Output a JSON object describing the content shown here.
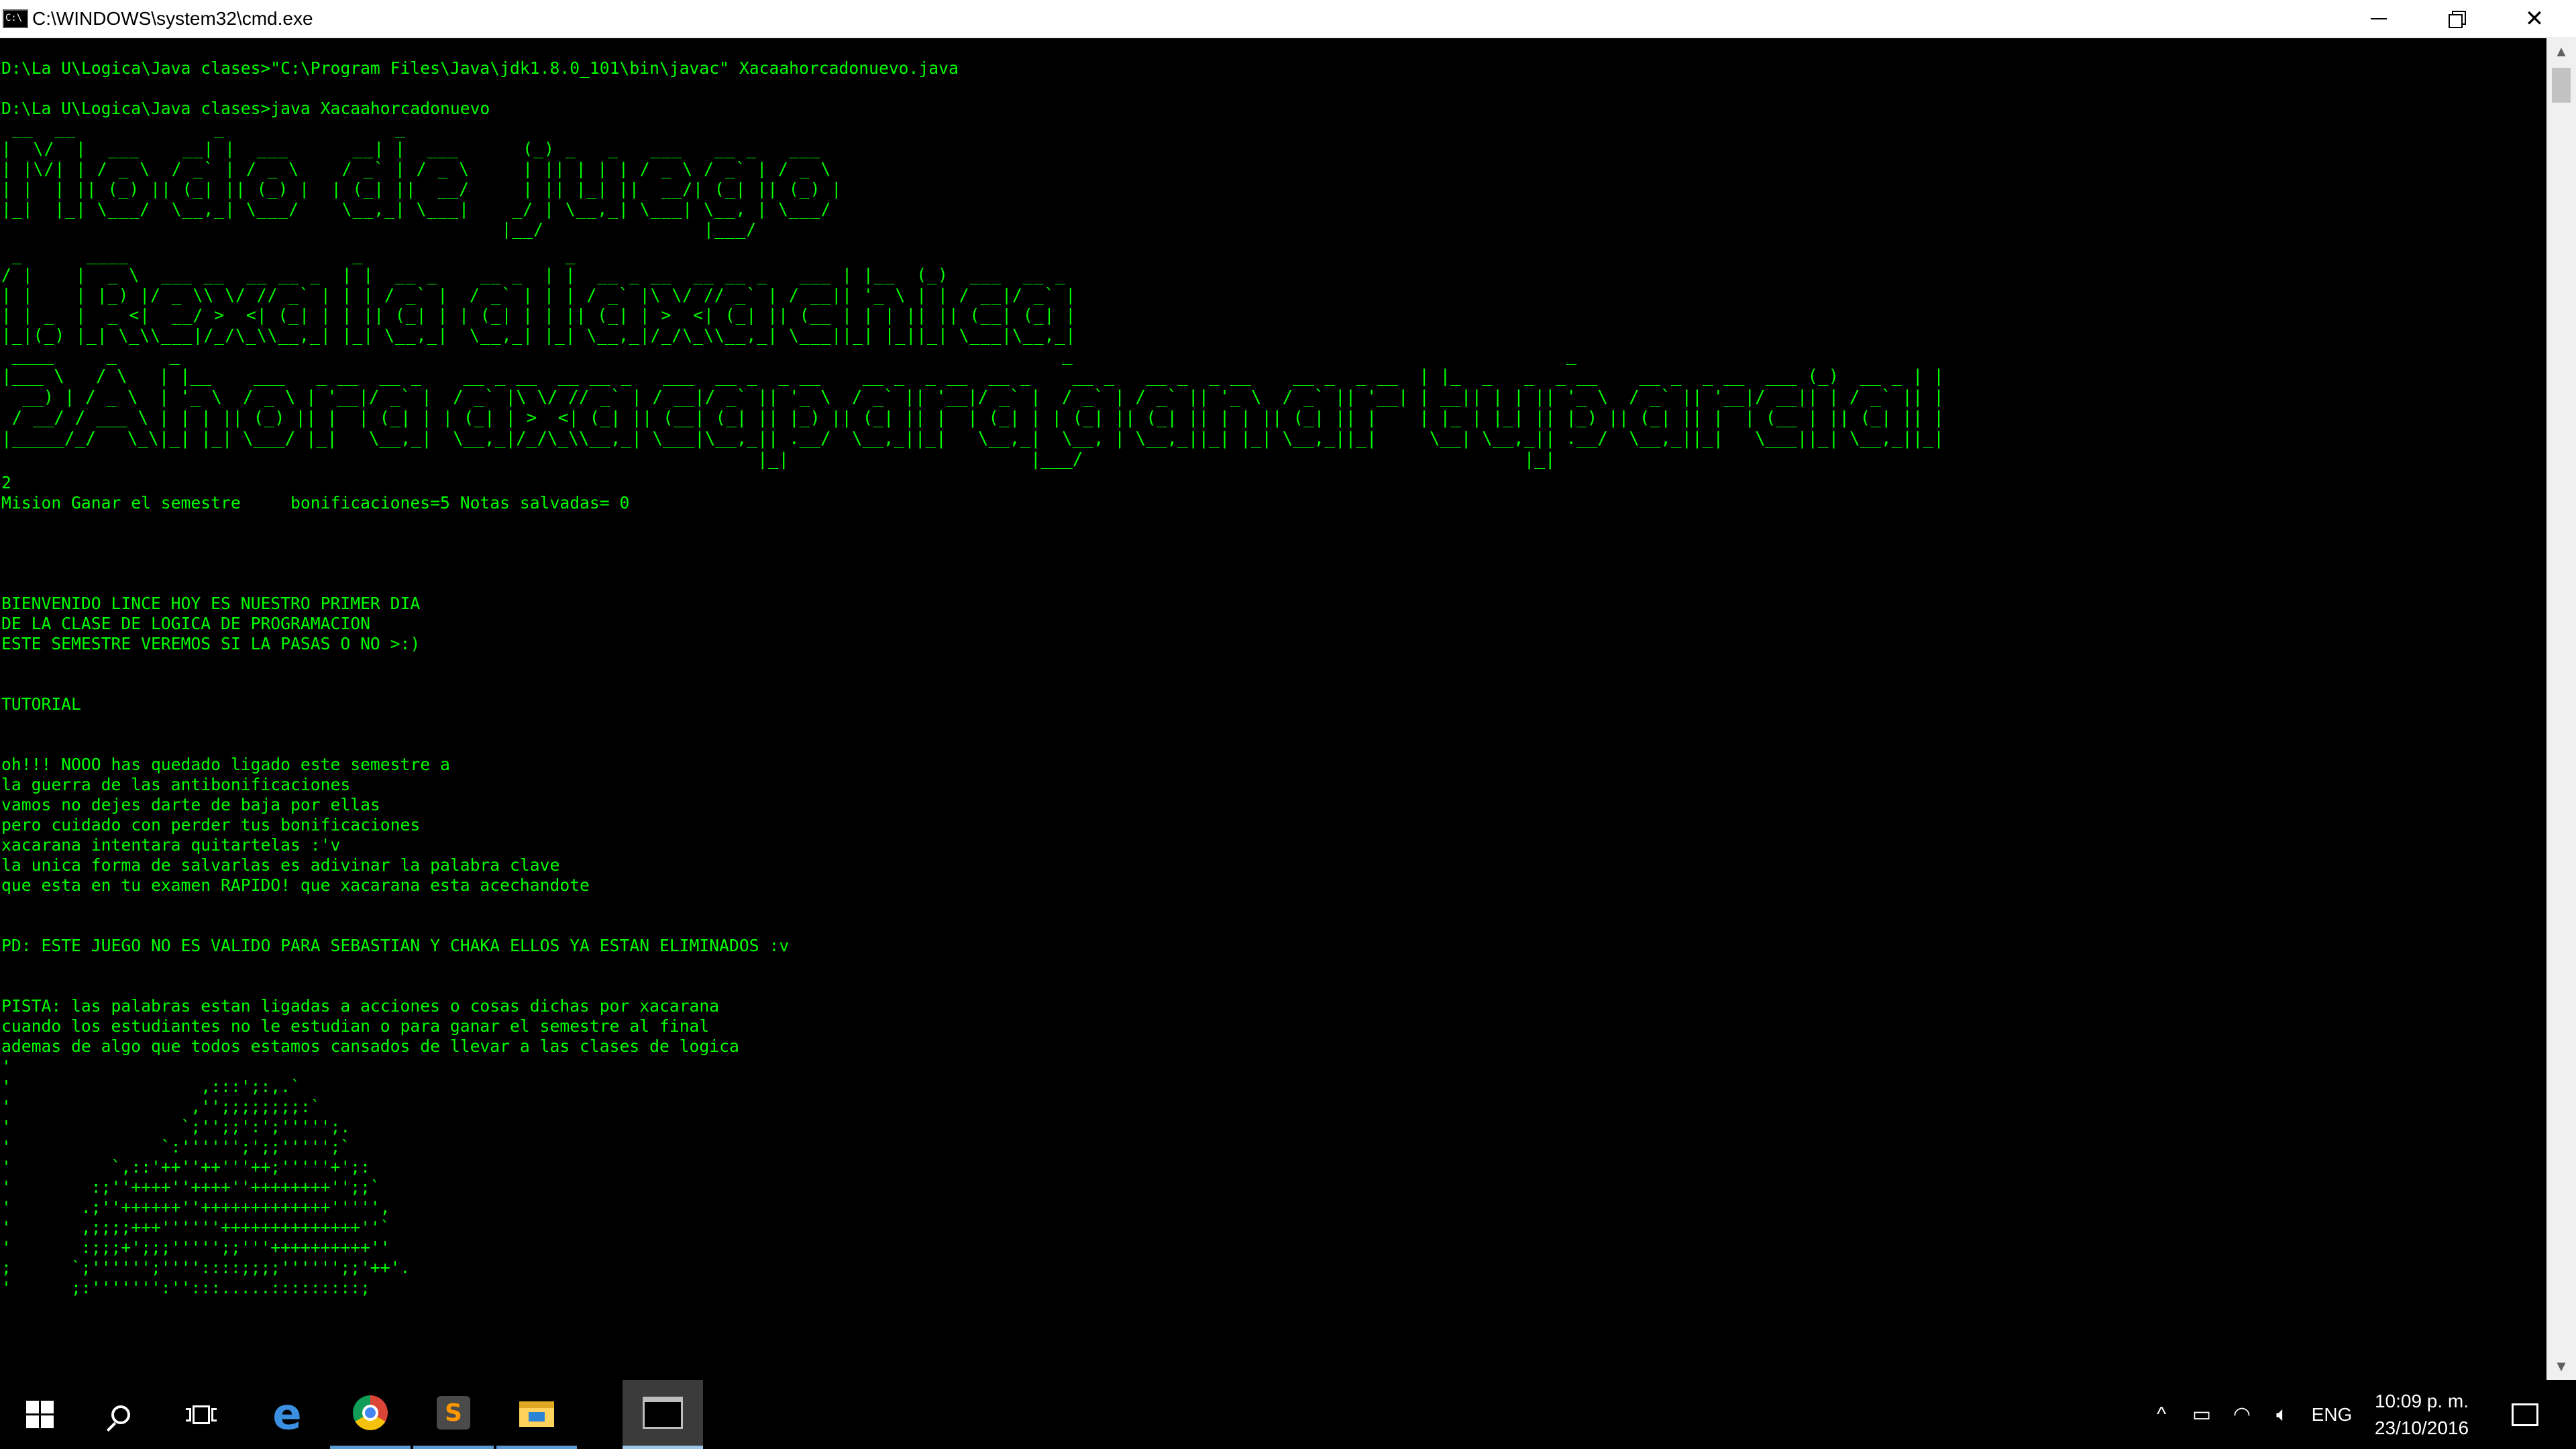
{
  "window": {
    "title": "C:\\WINDOWS\\system32\\cmd.exe",
    "icon_text": "C:\\"
  },
  "console": {
    "lines_top": "\nD:\\La U\\Logica\\Java clases>\"C:\\Program Files\\Java\\jdk1.8.0_101\\bin\\javac\" Xacaahorcadonuevo.java\n\nD:\\La U\\Logica\\Java clases>java Xacaahorcadonuevo",
    "banner_modo": " __  __             _                _\n|  \\/  |  ___    __| |  ___      __| |  ___      (_) _   _   ___   __ _   ___\n| |\\/| | / _ \\  / _` | / _ \\    / _` | / _ \\     | || | | | / _ \\ / _` | / _ \\\n| |  | || (_) || (_| || (_) |  | (_| ||  __/     | || |_| ||  __/| (_| || (_) |\n|_|  |_| \\___/  \\__,_| \\___/    \\__,_| \\___|    _/ | \\__,_| \\___| \\__, | \\___/\n                                               |__/               |___/",
    "banner_option1": " _      ____                     _                   _\n/ |    |  _ \\  ___ __  __ __ _  | |  __ _    __ _  | |  __ _ __  __ __ _   ___ | |__  (_)  ___  __ _\n| |    | |_) |/ _ \\\\ \\/ // _` | | | / _` |  / _` | | | / _` |\\ \\/ // _` | / __|| '_ \\ | | / __|/ _` |\n| | _  |  _ <|  __/ >  <| (_| | | || (_| | | (_| | | || (_| | >  <| (_| || (__ | | | || || (__| (_| |\n|_|(_) |_| \\_\\\\___|/_/\\_\\\\__,_| |_| \\__,_|  \\__,_| |_| \\__,_|/_/\\_\\\\__,_| \\___||_| |_||_| \\___|\\__,_|",
    "banner_option2": " ____     _     _                                                                                    _                                               _\n|___ \\   / \\   | |__    ___   _ __  __ _    __ _ __  __ __ _   ___  __ _  _ __    __ _  _ __  __ _    __ _   __ _  _ __    __ _  _ __  | |_  _   _  _ __    __ _  _ __  ___ (_)  __ _ | |\n  __) | / _ \\  | '_ \\  / _ \\ | '__|/ _` |  / _` |\\ \\/ // _` | / __|/ _` || '_ \\  / _` || '__|/ _` |  / _` | / _` || '_ \\  / _` || '__| | __|| | | || '_ \\  / _` || '__|/ __|| | / _` || |\n / __/ / ___ \\ | | | || (_) || |  | (_| | | (_| | >  <| (_| || (__| (_| || |_) || (_| || |  | (_| | | (_| || (_| || | | || (_| || |    | |_ | |_| || |_) || (_| || |  | (__ | || (_| || |\n|_____/_/   \\_\\|_| |_| \\___/ |_|   \\__,_|  \\__,_|/_/\\_\\\\__,_| \\___|\\__,_|| .__/  \\__,_||_|   \\__,_|  \\__, | \\__,_||_| |_| \\__,_||_|     \\__| \\__,_|| .__/  \\__,_||_|   \\___||_| \\__,_||_|\n                                                                        |_|                       |___/                                          |_|",
    "lines_bottom": "2\nMision Ganar el semestre     bonificaciones=5 Notas salvadas= 0\n\n\n\n\nBIENVENIDO LINCE HOY ES NUESTRO PRIMER DIA\nDE LA CLASE DE LOGICA DE PROGRAMACION\nESTE SEMESTRE VEREMOS SI LA PASAS O NO >:)\n\n\nTUTORIAL\n\n\noh!!! NOOO has quedado ligado este semestre a\nla guerra de las antibonificaciones\nvamos no dejes darte de baja por ellas\npero cuidado con perder tus bonificaciones\nxacarana intentara quitartelas :'v\nla unica forma de salvarlas es adivinar la palabra clave\nque esta en tu examen RAPIDO! que xacarana esta acechandote\n\n\nPD: ESTE JUEGO NO ES VALIDO PARA SEBASTIAN Y CHAKA ELLOS YA ESTAN ELIMINADOS :v\n\n\nPISTA: las palabras estan ligadas a acciones o cosas dichas por xacarana\ncuando los estudiantes no le estudian o para ganar el semestre al final\nademas de algo que todos estamos cansados de llevar a las clases de logica",
    "ascii_art": "'\n'                   ,:::';:,.`\n'                  ,'';;;;;;;;:`\n'                 `;'';;':';''''';.\n'               `:'''''';';;''''';`\n'          `,::'++''++'''++;'''''+';:\n'        :;''++++''++++''++++++++'';;`\n'       .;''++++++''+++++++++++++''''',\n'       ,;;;;+++''''''++++++++++++++''`\n'       :;;;+';;;''''';;'''++++++++++''\n;      `;'''''';''''::::;;;;'''''';;'++'.\n'      ;:''''''':'':::.....:::::::::;"
  },
  "taskbar": {
    "apps": [
      {
        "name": "start",
        "icon": "windows-logo-icon"
      },
      {
        "name": "search",
        "icon": "search-icon"
      },
      {
        "name": "task-view",
        "icon": "task-view-icon"
      },
      {
        "name": "edge",
        "icon": "edge-icon",
        "glyph": "e"
      },
      {
        "name": "chrome",
        "icon": "chrome-icon"
      },
      {
        "name": "sublime-text",
        "icon": "sublime-icon",
        "glyph": "S"
      },
      {
        "name": "file-explorer",
        "icon": "folder-icon"
      },
      {
        "name": "cmd",
        "icon": "cmd-icon"
      }
    ],
    "tray": {
      "chevron": "^",
      "language": "ENG",
      "time": "10:09 p. m.",
      "date": "23/10/2016"
    }
  },
  "colors": {
    "console_text": "#00ff00",
    "console_bg": "#000000",
    "taskbar_bg": "#000000",
    "accent": "#5b9bd5"
  }
}
